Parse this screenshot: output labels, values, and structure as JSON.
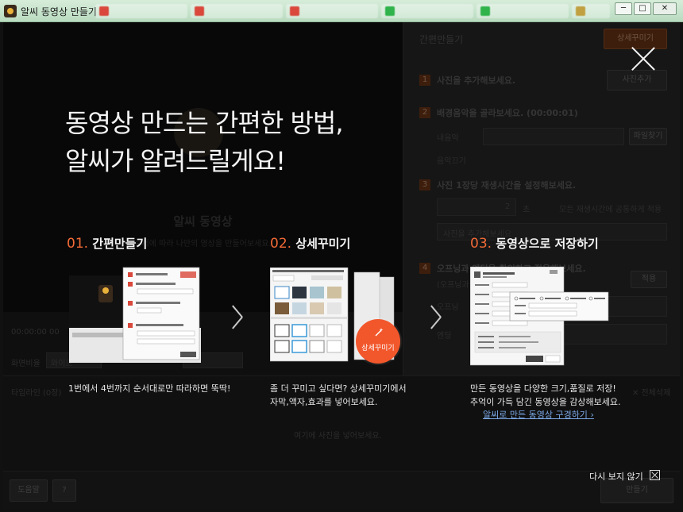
{
  "window": {
    "title": "알씨 동영상 만들기",
    "controls": {
      "minimize": "─",
      "maximize": "□",
      "close": "✕"
    }
  },
  "background_tabs": [
    {
      "color": "#d9483b"
    },
    {
      "color": "#d9483b"
    },
    {
      "color": "#d9483b"
    },
    {
      "color": "#2fb34a"
    },
    {
      "color": "#2fb34a"
    },
    {
      "color": "#c0a040"
    }
  ],
  "app": {
    "stage": {
      "title": "알씨 동영상",
      "subtitle": "순서에 따라 나만의 영상을 만들어보세요."
    },
    "right_panel": {
      "header": "간편만들기",
      "detail_button": "상세꾸미기",
      "steps": [
        {
          "num": "1",
          "text": "사진을 추가해보세요."
        },
        {
          "num": "2",
          "text": "배경음악을 골라보세요. (00:00:01)"
        },
        {
          "num": "3",
          "text": "사진 1장당 재생시간을 설정해보세요."
        },
        {
          "num": "4",
          "text": "오프닝과 엔딩을 확인하고 적용해보세요."
        }
      ],
      "add_photo_button": "사진추가",
      "my_music": "내음악",
      "music_off": "음악끄기",
      "file_find": "파일찾기",
      "seconds_value": "2",
      "seconds_unit": "초",
      "apply_same": "모든 재생시간에 공통하게 적용",
      "add_photo_hint": "사진을 추가해보세요",
      "opening_hint": "(오프닝과",
      "opening": "오프닝",
      "ending": "엔딩",
      "apply_button": "적용"
    },
    "controls": {
      "time": "00:00:00",
      "time2": "00",
      "ratio": "화면비율",
      "ratio_value": "와이드"
    },
    "timeline": {
      "label": "타임라인 (0장)",
      "empty_hint": "여기에 사진을 넣어보세요.",
      "delete_all": "✕ 전체삭제"
    },
    "footer": {
      "help": "도움말",
      "question": "?",
      "make": "만들기"
    }
  },
  "overlay": {
    "headline_line1": "동영상 만드는 간편한 방법,",
    "headline_line2": "알씨가 알려드릴게요!",
    "steps": [
      {
        "num": "01.",
        "title": "간편만들기",
        "desc_line1": "1번에서 4번까지 순서대로만 따라하면 뚝딱!"
      },
      {
        "num": "02.",
        "title": "상세꾸미기",
        "desc_line1": "좀 더 꾸미고 싶다면? 상세꾸미기에서",
        "desc_line2": "자막,액자,효과를 넣어보세요.",
        "badge": "상세꾸미기"
      },
      {
        "num": "03.",
        "title": "동영상으로 저장하기",
        "desc_line1": "만든 동영상을 다양한 크기,품질로 저장!",
        "desc_line2": "추억이 가득 담긴 동영상을 감상해보세요.",
        "link": "알씨로 만든 동영상 구경하기"
      }
    ],
    "dont_show_again": "다시 보지 않기",
    "accent": "#f26a36"
  }
}
